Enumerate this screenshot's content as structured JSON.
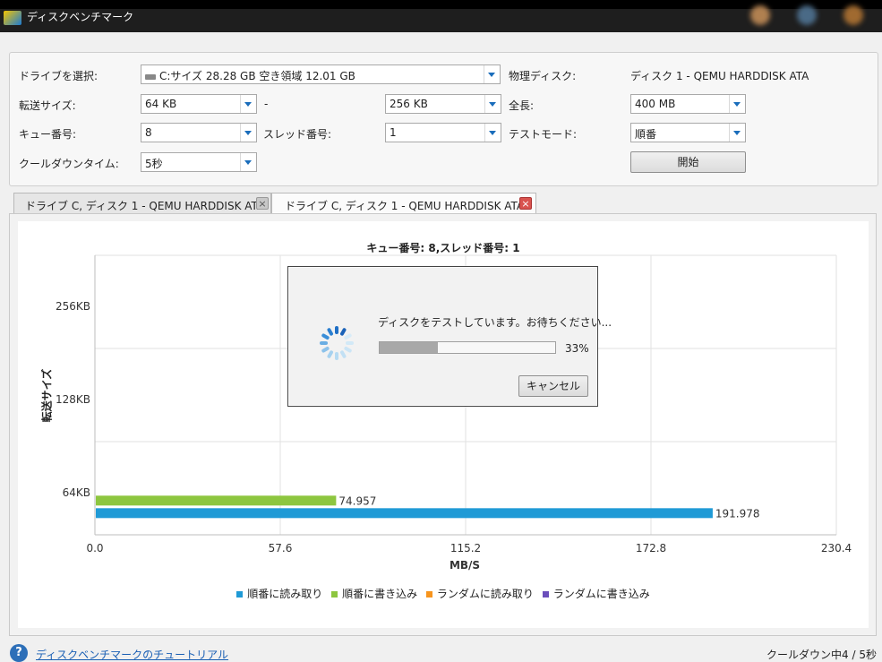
{
  "window": {
    "title": "ディスクベンチマーク"
  },
  "settings": {
    "drive_label": "ドライブを選択:",
    "drive_value": "C:サイズ 28.28 GB 空き領域 12.01 GB",
    "physical_label": "物理ディスク:",
    "physical_value": "ディスク 1 - QEMU HARDDISK ATA",
    "transfer_label": "転送サイズ:",
    "transfer_from": "64 KB",
    "transfer_dash": "-",
    "transfer_to": "256 KB",
    "length_label": "全長:",
    "length_value": "400 MB",
    "queue_label": "キュー番号:",
    "queue_value": "8",
    "thread_label": "スレッド番号:",
    "thread_value": "1",
    "mode_label": "テストモード:",
    "mode_value": "順番",
    "cooldown_label": "クールダウンタイム:",
    "cooldown_value": "5秒",
    "start_button": "開始"
  },
  "tabs": [
    {
      "label": "ドライブ C, ディスク 1 - QEMU HARDDISK ATA"
    },
    {
      "label": "ドライブ C, ディスク 1 - QEMU HARDDISK ATA"
    }
  ],
  "dialog": {
    "message": "ディスクをテストしています。お待ちください...",
    "progress": 0.33,
    "progress_text": "33%",
    "cancel_button": "キャンセル"
  },
  "chart_data": {
    "type": "bar",
    "orientation": "horizontal",
    "title": "キュー番号: 8,スレッド番号: 1",
    "xlabel": "MB/S",
    "ylabel": "転送サイズ",
    "xlim": [
      0.0,
      230.4
    ],
    "x_ticks": [
      "0.0",
      "57.6",
      "115.2",
      "172.8",
      "230.4"
    ],
    "categories": [
      "64KB",
      "128KB",
      "256KB"
    ],
    "grid": true,
    "legend_position": "bottom",
    "series": [
      {
        "name": "順番に読み取り",
        "color": "#1f9ad6",
        "values": [
          191.978,
          null,
          null
        ],
        "labels": [
          "191.978",
          "",
          ""
        ]
      },
      {
        "name": "順番に書き込み",
        "color": "#8dc63f",
        "values": [
          74.957,
          null,
          null
        ],
        "labels": [
          "74.957",
          "",
          ""
        ]
      },
      {
        "name": "ランダムに読み取り",
        "color": "#f7941d",
        "values": [
          null,
          null,
          null
        ],
        "labels": [
          "",
          "",
          ""
        ]
      },
      {
        "name": "ランダムに書き込み",
        "color": "#6b4fbb",
        "values": [
          null,
          null,
          null
        ],
        "labels": [
          "",
          "",
          ""
        ]
      }
    ]
  },
  "footer": {
    "help_icon": "question-icon",
    "help_text": "?",
    "tutorial_link": "ディスクベンチマークのチュートリアル",
    "status": "クールダウン中4 / 5秒"
  }
}
